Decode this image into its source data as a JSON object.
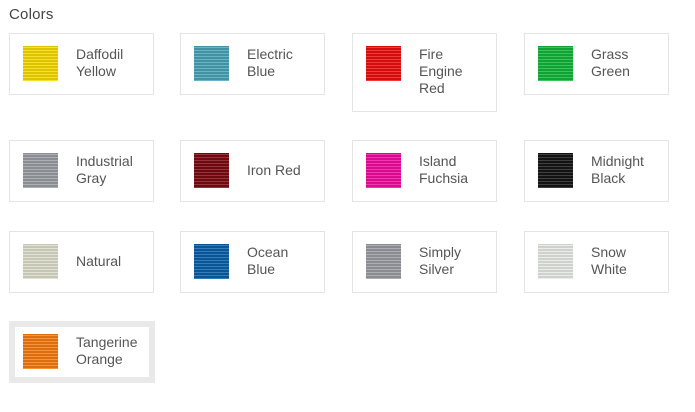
{
  "section": {
    "title": "Colors"
  },
  "colors": [
    {
      "lines": [
        "Daffodil",
        "Yellow"
      ],
      "hex": "#f7d900"
    },
    {
      "lines": [
        "Electric",
        "Blue"
      ],
      "hex": "#4aa3b7"
    },
    {
      "lines": [
        "Fire",
        "Engine",
        "Red"
      ],
      "hex": "#ea0f0f"
    },
    {
      "lines": [
        "Grass",
        "Green"
      ],
      "hex": "#13b43a"
    },
    {
      "lines": [
        "Industrial",
        "Gray"
      ],
      "hex": "#9a9ea2"
    },
    {
      "lines": [
        "Iron Red"
      ],
      "hex": "#7a0a12"
    },
    {
      "lines": [
        "Island",
        "Fuchsia"
      ],
      "hex": "#f00c9e"
    },
    {
      "lines": [
        "Midnight",
        "Black"
      ],
      "hex": "#151515"
    },
    {
      "lines": [
        "Natural"
      ],
      "hex": "#dcdcca"
    },
    {
      "lines": [
        "Ocean",
        "Blue"
      ],
      "hex": "#0a5fa8"
    },
    {
      "lines": [
        "Simply",
        "Silver"
      ],
      "hex": "#9a9ca1"
    },
    {
      "lines": [
        "Snow",
        "White"
      ],
      "hex": "#e6e9e4"
    },
    {
      "lines": [
        "Tangerine",
        "Orange"
      ],
      "hex": "#f47b10"
    }
  ],
  "selected_index": 12
}
